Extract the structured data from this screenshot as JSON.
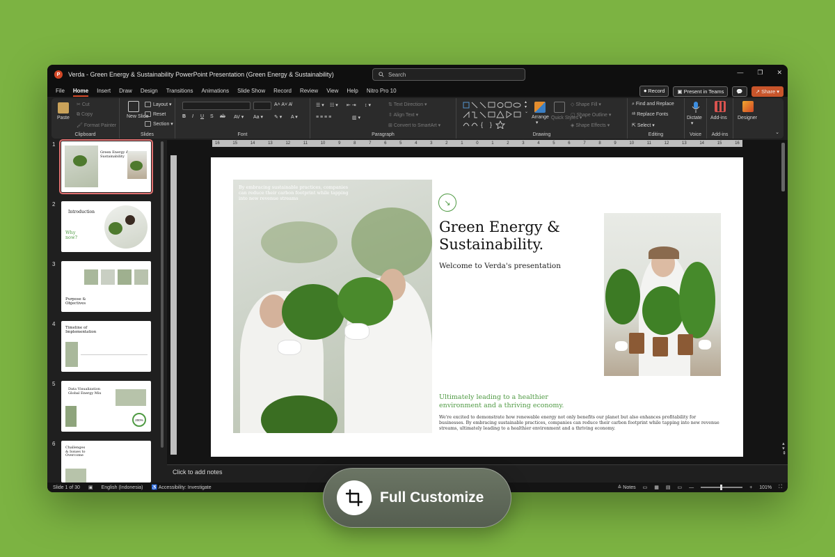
{
  "window": {
    "title": "Verda - Green Energy & Sustainability PowerPoint Presentation (Green Energy & Sustainability)",
    "search_placeholder": "Search"
  },
  "menu": {
    "tabs": [
      "File",
      "Home",
      "Insert",
      "Draw",
      "Design",
      "Transitions",
      "Animations",
      "Slide Show",
      "Record",
      "Review",
      "View",
      "Help",
      "Nitro Pro 10"
    ],
    "active": "Home",
    "record": "Record",
    "present_teams": "Present in Teams",
    "share": "Share"
  },
  "ribbon": {
    "clipboard": {
      "label": "Clipboard",
      "paste": "Paste",
      "cut": "Cut",
      "copy": "Copy",
      "format_painter": "Format Painter"
    },
    "slides": {
      "label": "Slides",
      "new_slide": "New Slide",
      "layout": "Layout",
      "reset": "Reset",
      "section": "Section"
    },
    "font": {
      "label": "Font"
    },
    "paragraph": {
      "label": "Paragraph",
      "text_direction": "Text Direction",
      "align_text": "Align Text",
      "smartart": "Convert to SmartArt"
    },
    "drawing": {
      "label": "Drawing",
      "arrange": "Arrange",
      "quick_styles": "Quick Styles",
      "shape_fill": "Shape Fill",
      "shape_outline": "Shape Outline",
      "shape_effects": "Shape Effects"
    },
    "editing": {
      "label": "Editing",
      "find_replace": "Find and Replace",
      "replace_fonts": "Replace Fonts",
      "select": "Select"
    },
    "voice": {
      "label": "Voice",
      "dictate": "Dictate"
    },
    "addins": {
      "label": "Add-ins",
      "addins": "Add-ins"
    },
    "designer": {
      "designer": "Designer"
    }
  },
  "thumbnails": [
    {
      "num": "1",
      "title": "Green Energy & Sustainability"
    },
    {
      "num": "2",
      "title": "Introduction",
      "sub": "Why now?"
    },
    {
      "num": "3",
      "title": "Purpose & Objectives"
    },
    {
      "num": "4",
      "title": "Timeline of Implementation"
    },
    {
      "num": "5",
      "title": "Data Visualization Global Energy Mix",
      "badge": "200%"
    },
    {
      "num": "6",
      "title": "Challenges & Issues to Overcome"
    }
  ],
  "ruler": {
    "h_ticks": [
      "16",
      "15",
      "14",
      "13",
      "12",
      "11",
      "10",
      "9",
      "8",
      "7",
      "6",
      "5",
      "4",
      "3",
      "2",
      "1",
      "0",
      "1",
      "2",
      "3",
      "4",
      "5",
      "6",
      "7",
      "8",
      "9",
      "10",
      "11",
      "12",
      "13",
      "14",
      "15",
      "16"
    ]
  },
  "slide": {
    "caption": "By embracing sustainable practices, companies can reduce their carbon footprint while tapping into new revenue streams",
    "title": "Green Energy & Sustainability.",
    "subtitle": "Welcome to Verda's presentation",
    "green_text": "Ultimately leading to a healthier environment and a thriving economy.",
    "body": "We're excited to demonstrate how renewable energy not only benefits our planet but also enhances profitability for businesses. By embracing sustainable practices, companies can reduce their carbon footprint while tapping into new revenue streams, ultimately leading to a healthier environment and a thriving economy."
  },
  "notes": {
    "placeholder": "Click to add notes"
  },
  "status": {
    "slide_count": "Slide 1 of 30",
    "language": "English (Indonesia)",
    "accessibility": "Accessibility: Investigate",
    "notes": "Notes",
    "zoom": "101%"
  },
  "badge": {
    "label": "Full Customize"
  },
  "colors": {
    "background": "#7cb342",
    "accent_green": "#4f9a43",
    "office_red": "#d24726",
    "share": "#c8552b"
  }
}
